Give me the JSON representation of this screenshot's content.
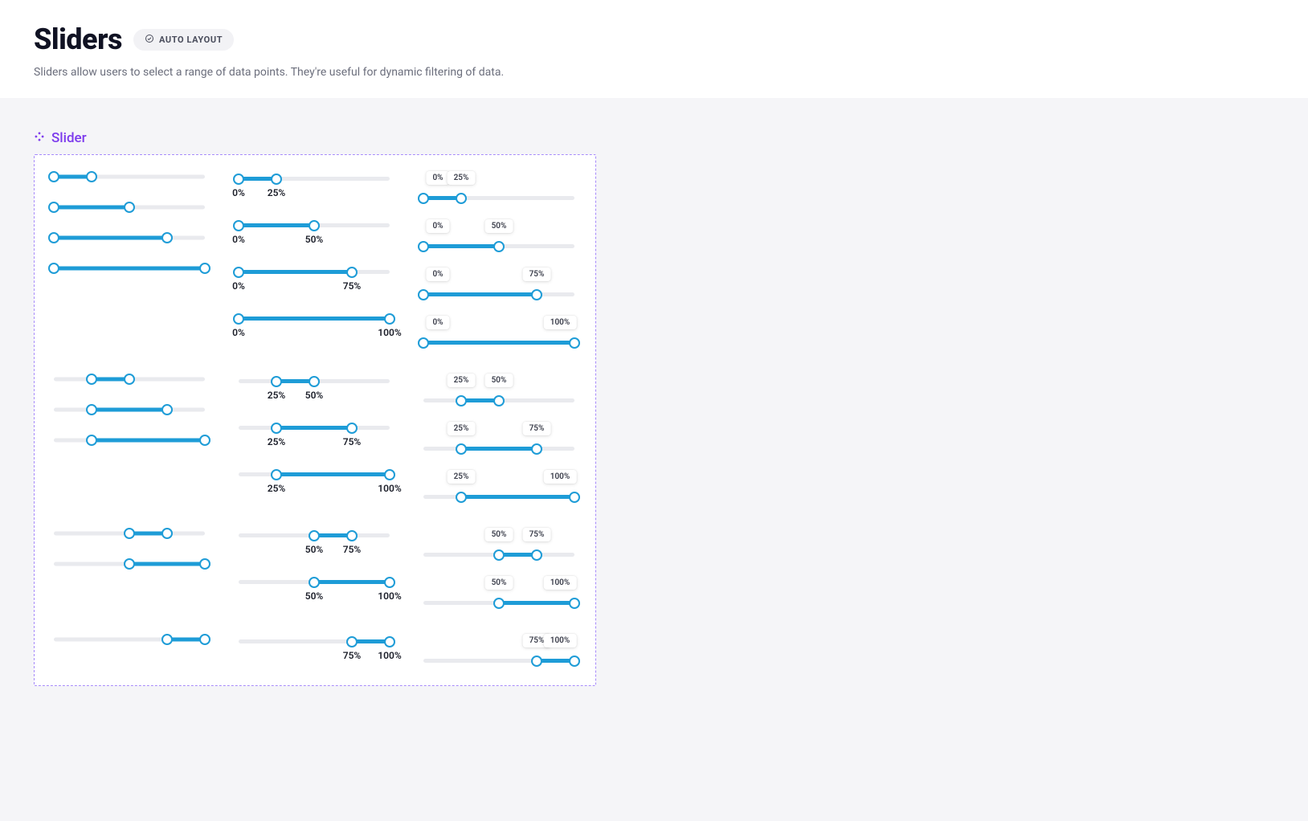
{
  "header": {
    "title": "Sliders",
    "badge": "AUTO LAYOUT",
    "description": "Sliders allow users to select a range of data points. They're useful for dynamic filtering of data."
  },
  "section": {
    "title": "Slider"
  },
  "colors": {
    "accent": "#1e9cd7",
    "frame_border": "#a78bfa",
    "section_label": "#7c3aed"
  },
  "slider_rows": [
    {
      "plain": [
        {
          "start": 0,
          "end": 25
        },
        {
          "start": 0,
          "end": 50
        },
        {
          "start": 0,
          "end": 75
        },
        {
          "start": 0,
          "end": 100
        }
      ],
      "below": [
        {
          "start": 0,
          "end": 25,
          "startLabel": "0%",
          "endLabel": "25%"
        },
        {
          "start": 0,
          "end": 50,
          "startLabel": "0%",
          "endLabel": "50%"
        },
        {
          "start": 0,
          "end": 75,
          "startLabel": "0%",
          "endLabel": "75%"
        },
        {
          "start": 0,
          "end": 100,
          "startLabel": "0%",
          "endLabel": "100%"
        }
      ],
      "tooltip": [
        {
          "start": 0,
          "end": 25,
          "startLabel": "0%",
          "endLabel": "25%"
        },
        {
          "start": 0,
          "end": 50,
          "startLabel": "0%",
          "endLabel": "50%"
        },
        {
          "start": 0,
          "end": 75,
          "startLabel": "0%",
          "endLabel": "75%"
        },
        {
          "start": 0,
          "end": 100,
          "startLabel": "0%",
          "endLabel": "100%"
        }
      ]
    },
    {
      "plain": [
        {
          "start": 25,
          "end": 50
        },
        {
          "start": 25,
          "end": 75
        },
        {
          "start": 25,
          "end": 100
        }
      ],
      "below": [
        {
          "start": 25,
          "end": 50,
          "startLabel": "25%",
          "endLabel": "50%"
        },
        {
          "start": 25,
          "end": 75,
          "startLabel": "25%",
          "endLabel": "75%"
        },
        {
          "start": 25,
          "end": 100,
          "startLabel": "25%",
          "endLabel": "100%"
        }
      ],
      "tooltip": [
        {
          "start": 25,
          "end": 50,
          "startLabel": "25%",
          "endLabel": "50%"
        },
        {
          "start": 25,
          "end": 75,
          "startLabel": "25%",
          "endLabel": "75%"
        },
        {
          "start": 25,
          "end": 100,
          "startLabel": "25%",
          "endLabel": "100%"
        }
      ]
    },
    {
      "plain": [
        {
          "start": 50,
          "end": 75
        },
        {
          "start": 50,
          "end": 100
        }
      ],
      "below": [
        {
          "start": 50,
          "end": 75,
          "startLabel": "50%",
          "endLabel": "75%"
        },
        {
          "start": 50,
          "end": 100,
          "startLabel": "50%",
          "endLabel": "100%"
        }
      ],
      "tooltip": [
        {
          "start": 50,
          "end": 75,
          "startLabel": "50%",
          "endLabel": "75%"
        },
        {
          "start": 50,
          "end": 100,
          "startLabel": "50%",
          "endLabel": "100%"
        }
      ]
    },
    {
      "plain": [
        {
          "start": 75,
          "end": 100
        }
      ],
      "below": [
        {
          "start": 75,
          "end": 100,
          "startLabel": "75%",
          "endLabel": "100%"
        }
      ],
      "tooltip": [
        {
          "start": 75,
          "end": 100,
          "startLabel": "75%",
          "endLabel": "100%"
        }
      ]
    }
  ]
}
